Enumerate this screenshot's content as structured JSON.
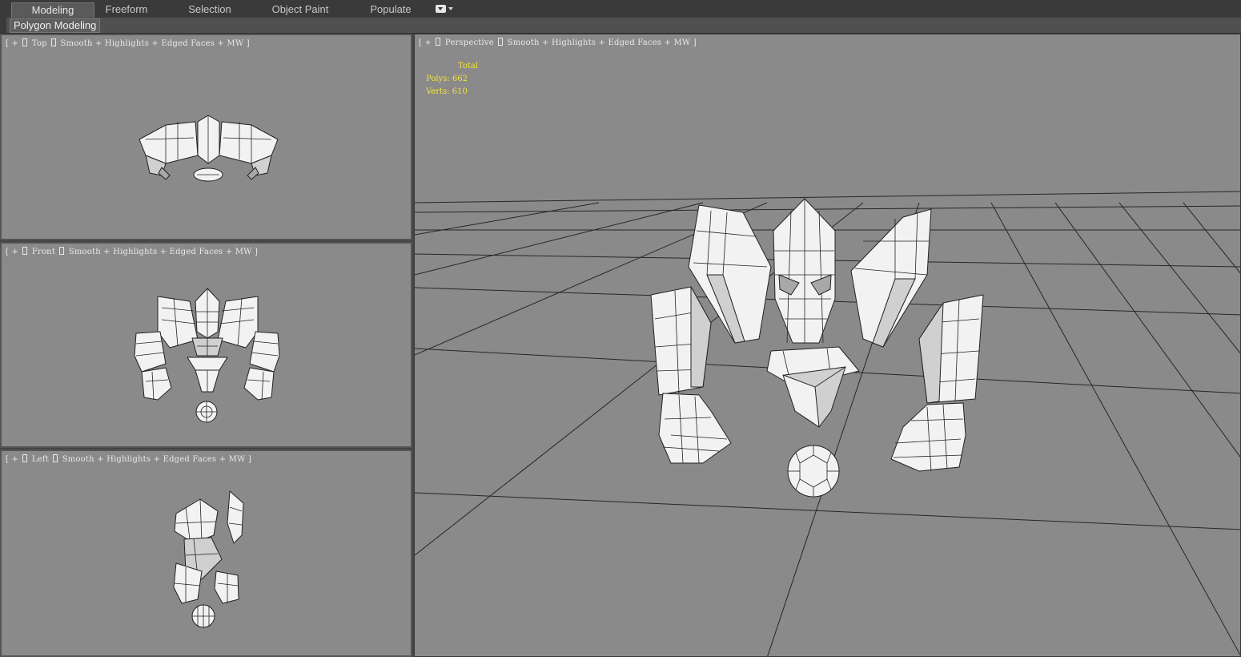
{
  "ribbon": {
    "tabs": [
      {
        "label": "Modeling",
        "active": true
      },
      {
        "label": "Freeform",
        "active": false
      },
      {
        "label": "Selection",
        "active": false
      },
      {
        "label": "Object Paint",
        "active": false
      },
      {
        "label": "Populate",
        "active": false
      }
    ],
    "menu_icon": "dropdown-menu-icon",
    "panel_label": "Polygon Modeling"
  },
  "viewports": {
    "top": {
      "label_pre": "[ + ]",
      "view": "Top",
      "mode": "Smooth + Highlights + Edged Faces + MW ]"
    },
    "front": {
      "label_pre": "[ + ]",
      "view": "Front",
      "mode": "Smooth + Highlights + Edged Faces + MW ]"
    },
    "left": {
      "label_pre": "[ + ]",
      "view": "Left",
      "mode": "Smooth + Highlights + Edged Faces + MW ]"
    },
    "perspective": {
      "label_pre": "[ + ]",
      "view": "Perspective",
      "mode": "Smooth + Highlights + Edged Faces + MW ]"
    }
  },
  "stats": {
    "total_label": "Total",
    "polys_label": "Polys:",
    "polys_value": "662",
    "verts_label": "Verts:",
    "verts_value": "610"
  },
  "colors": {
    "viewport_bg": "#8a8a8a",
    "stats_text": "#f3e43a",
    "ribbon_bg": "#3a3a3a"
  }
}
